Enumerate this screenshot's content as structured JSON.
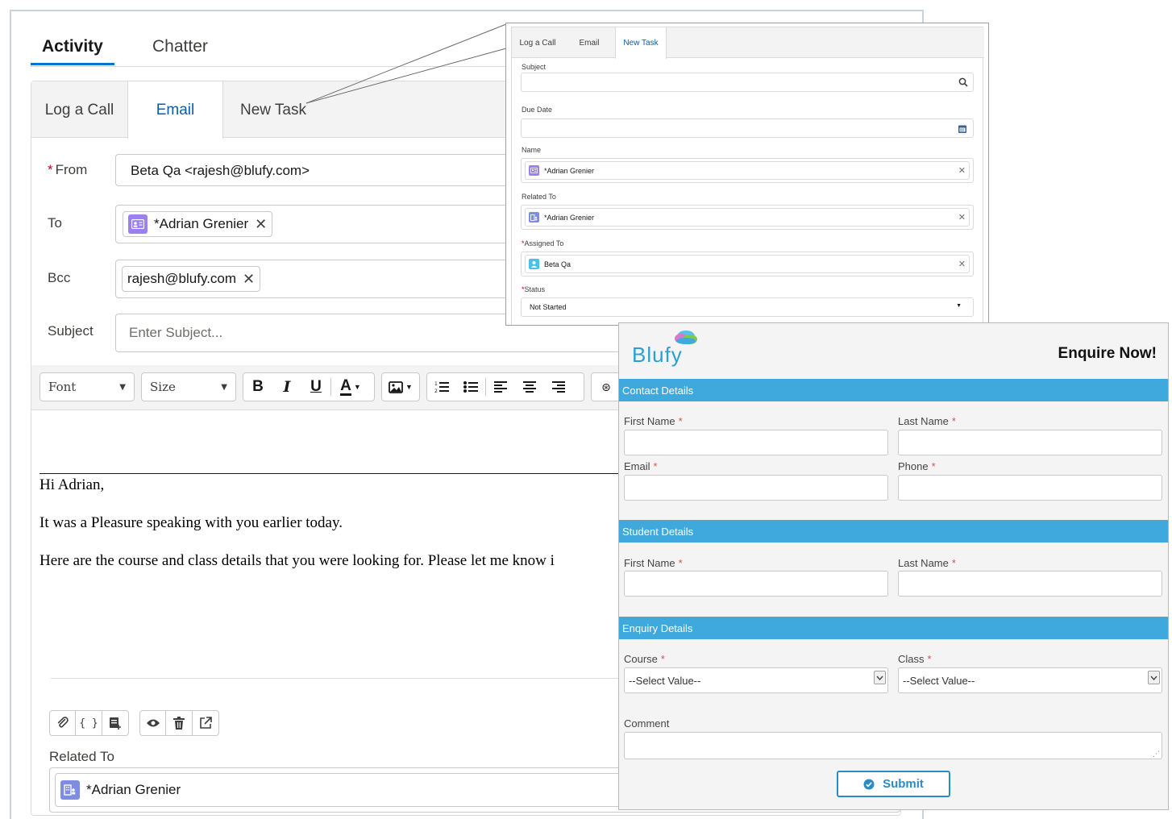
{
  "activity": {
    "tabs": [
      {
        "label": "Activity"
      },
      {
        "label": "Chatter"
      }
    ],
    "subtabs": [
      {
        "label": "Log a Call"
      },
      {
        "label": "Email"
      },
      {
        "label": "New Task"
      }
    ],
    "from": {
      "label": "From",
      "value": "Beta Qa <rajesh@blufy.com>"
    },
    "to": {
      "label": "To",
      "pill": "*Adrian Grenier"
    },
    "bcc": {
      "label": "Bcc",
      "pill": "rajesh@blufy.com"
    },
    "subject": {
      "label": "Subject",
      "placeholder": "Enter Subject..."
    },
    "toolbar": {
      "font": "Font",
      "size": "Size"
    },
    "body": [
      "Hi Adrian,",
      "It was a Pleasure speaking with you earlier today.",
      "Here are the course and class details that you were looking for. Please let me know i"
    ],
    "related_to": {
      "label": "Related To",
      "value": "*Adrian Grenier"
    }
  },
  "task": {
    "tabs": [
      {
        "label": "Log a Call"
      },
      {
        "label": "Email"
      },
      {
        "label": "New Task"
      }
    ],
    "subject_label": "Subject",
    "due_date_label": "Due Date",
    "name_label": "Name",
    "name_value": "*Adrian Grenier",
    "related_label": "Related To",
    "related_value": "*Adrian Grenier",
    "assigned_label": "Assigned To",
    "assigned_value": "Beta Qa",
    "status_label": "Status",
    "status_value": "Not Started"
  },
  "enquiry": {
    "logo": "Blufy",
    "title": "Enquire Now!",
    "sections": {
      "contact": "Contact Details",
      "student": "Student Details",
      "enquiry": "Enquiry Details"
    },
    "fields": {
      "first_name": "First Name",
      "last_name": "Last Name",
      "email": "Email",
      "phone": "Phone",
      "course": "Course",
      "class": "Class",
      "comment": "Comment",
      "select_placeholder": "--Select Value--",
      "required_mark": "*"
    },
    "submit": "Submit"
  },
  "colors": {
    "accent": "#0176d3",
    "section_bar": "#3fa9dd",
    "submit_border": "#2a8cc4",
    "required": "#ba0517"
  }
}
